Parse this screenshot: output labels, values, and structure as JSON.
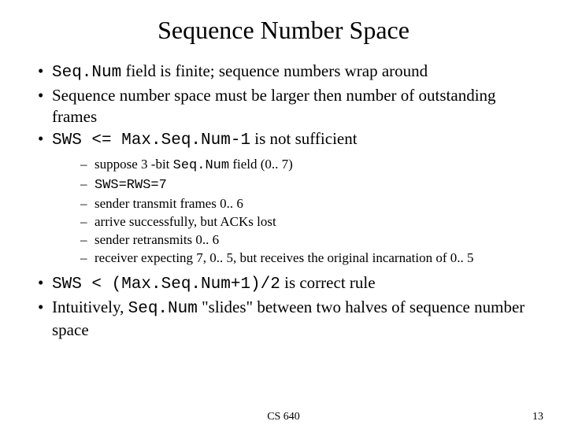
{
  "title": "Sequence Number Space",
  "bullets": {
    "b1_pre": "Seq.Num",
    "b1_post": " field is finite; sequence numbers wrap around",
    "b2": "Sequence number space must be larger then number of outstanding frames",
    "b3_pre": "SWS <= Max.Seq.Num-1",
    "b3_post": " is not sufficient",
    "b4_pre": "SWS < (Max.Seq.Num+1)/2",
    "b4_post": " is correct rule",
    "b5_a": "Intuitively, ",
    "b5_b": "Seq.Num",
    "b5_c": " \"slides\" between two halves of sequence number space"
  },
  "sub": {
    "s1_a": "suppose 3 -bit ",
    "s1_b": "Seq.Num",
    "s1_c": " field (0.. 7)",
    "s2": "SWS=RWS=7",
    "s3": "sender transmit frames 0.. 6",
    "s4": "arrive successfully, but ACKs lost",
    "s5": "sender retransmits 0.. 6",
    "s6": "receiver expecting 7, 0.. 5, but receives the original incarnation of 0.. 5"
  },
  "footer": {
    "course": "CS 640",
    "page": "13"
  }
}
